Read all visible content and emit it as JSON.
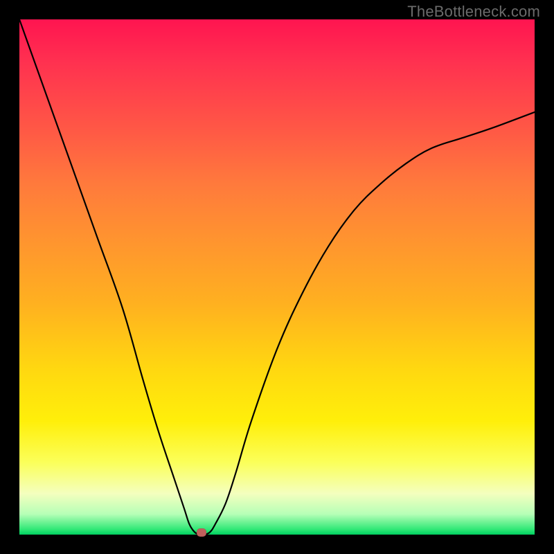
{
  "watermark": "TheBottleneck.com",
  "chart_data": {
    "type": "line",
    "title": "",
    "xlabel": "",
    "ylabel": "",
    "xlim": [
      0,
      100
    ],
    "ylim": [
      0,
      100
    ],
    "grid": false,
    "legend": false,
    "series": [
      {
        "name": "bottleneck-curve",
        "x": [
          0,
          5,
          10,
          15,
          20,
          24,
          27,
          30,
          32,
          33,
          34,
          35,
          36,
          37,
          38,
          40,
          42,
          45,
          50,
          55,
          60,
          65,
          70,
          75,
          80,
          86,
          92,
          100
        ],
        "y": [
          100,
          86,
          72,
          58,
          44,
          30,
          20,
          11,
          5,
          2,
          0.5,
          0,
          0,
          0.5,
          2,
          6,
          12,
          22,
          36,
          47,
          56,
          63,
          68,
          72,
          75,
          77,
          79,
          82
        ]
      }
    ],
    "annotations": [
      {
        "name": "minimum-marker",
        "x": 35.3,
        "y": 0,
        "color": "#c0605c"
      }
    ],
    "background_gradient": {
      "direction": "top-to-bottom",
      "stops": [
        {
          "pct": 0,
          "color": "#ff1450"
        },
        {
          "pct": 22,
          "color": "#ff5a45"
        },
        {
          "pct": 55,
          "color": "#ffb020"
        },
        {
          "pct": 78,
          "color": "#ffef0a"
        },
        {
          "pct": 99,
          "color": "#2fe876"
        },
        {
          "pct": 100,
          "color": "#00d060"
        }
      ]
    }
  }
}
